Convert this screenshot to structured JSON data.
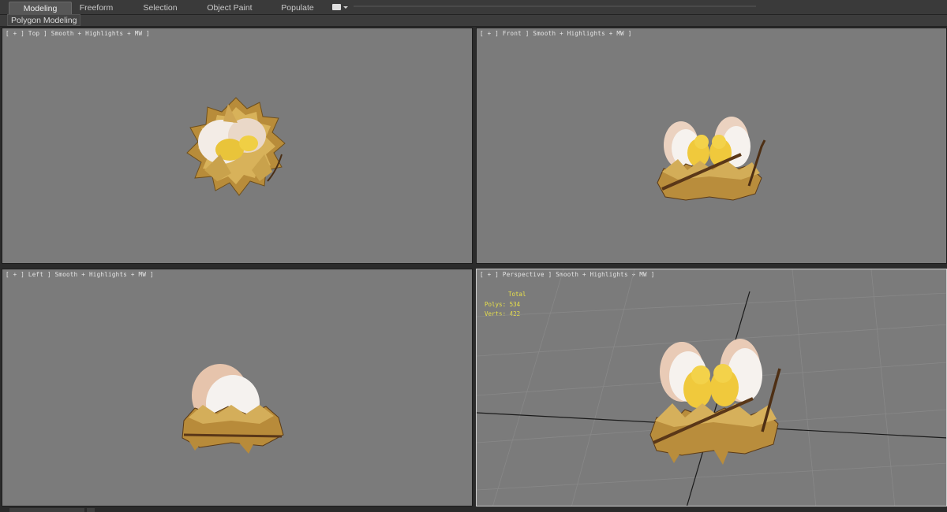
{
  "ribbon": {
    "tabs": [
      {
        "label": "Modeling",
        "active": true
      },
      {
        "label": "Freeform",
        "active": false
      },
      {
        "label": "Selection",
        "active": false
      },
      {
        "label": "Object Paint",
        "active": false
      },
      {
        "label": "Populate",
        "active": false
      }
    ],
    "panel_label": "Polygon Modeling"
  },
  "viewports": {
    "top": {
      "label": "[ + ] Top ] Smooth + Highlights + MW ]"
    },
    "front": {
      "label": "[ + ] Front ] Smooth + Highlights + MW ]"
    },
    "left": {
      "label": "[ + ] Left ] Smooth + Highlights + MW ]"
    },
    "perspective": {
      "label": "[ + ] Perspective ] Smooth + Highlights + MW ]",
      "stats": {
        "header": "Total",
        "polys_label": "Polys: 534",
        "verts_label": "Verts: 422"
      }
    }
  },
  "colors": {
    "viewport_bg": "#7b7b7b",
    "stats_text": "#e8e04a",
    "active_viewport_border": "#cfcfcf",
    "straw": "#c9a24c",
    "chick": "#f3d24a",
    "eggshell": "#f2ece6"
  },
  "icons": {
    "dropdown": "dropdown-icon"
  }
}
